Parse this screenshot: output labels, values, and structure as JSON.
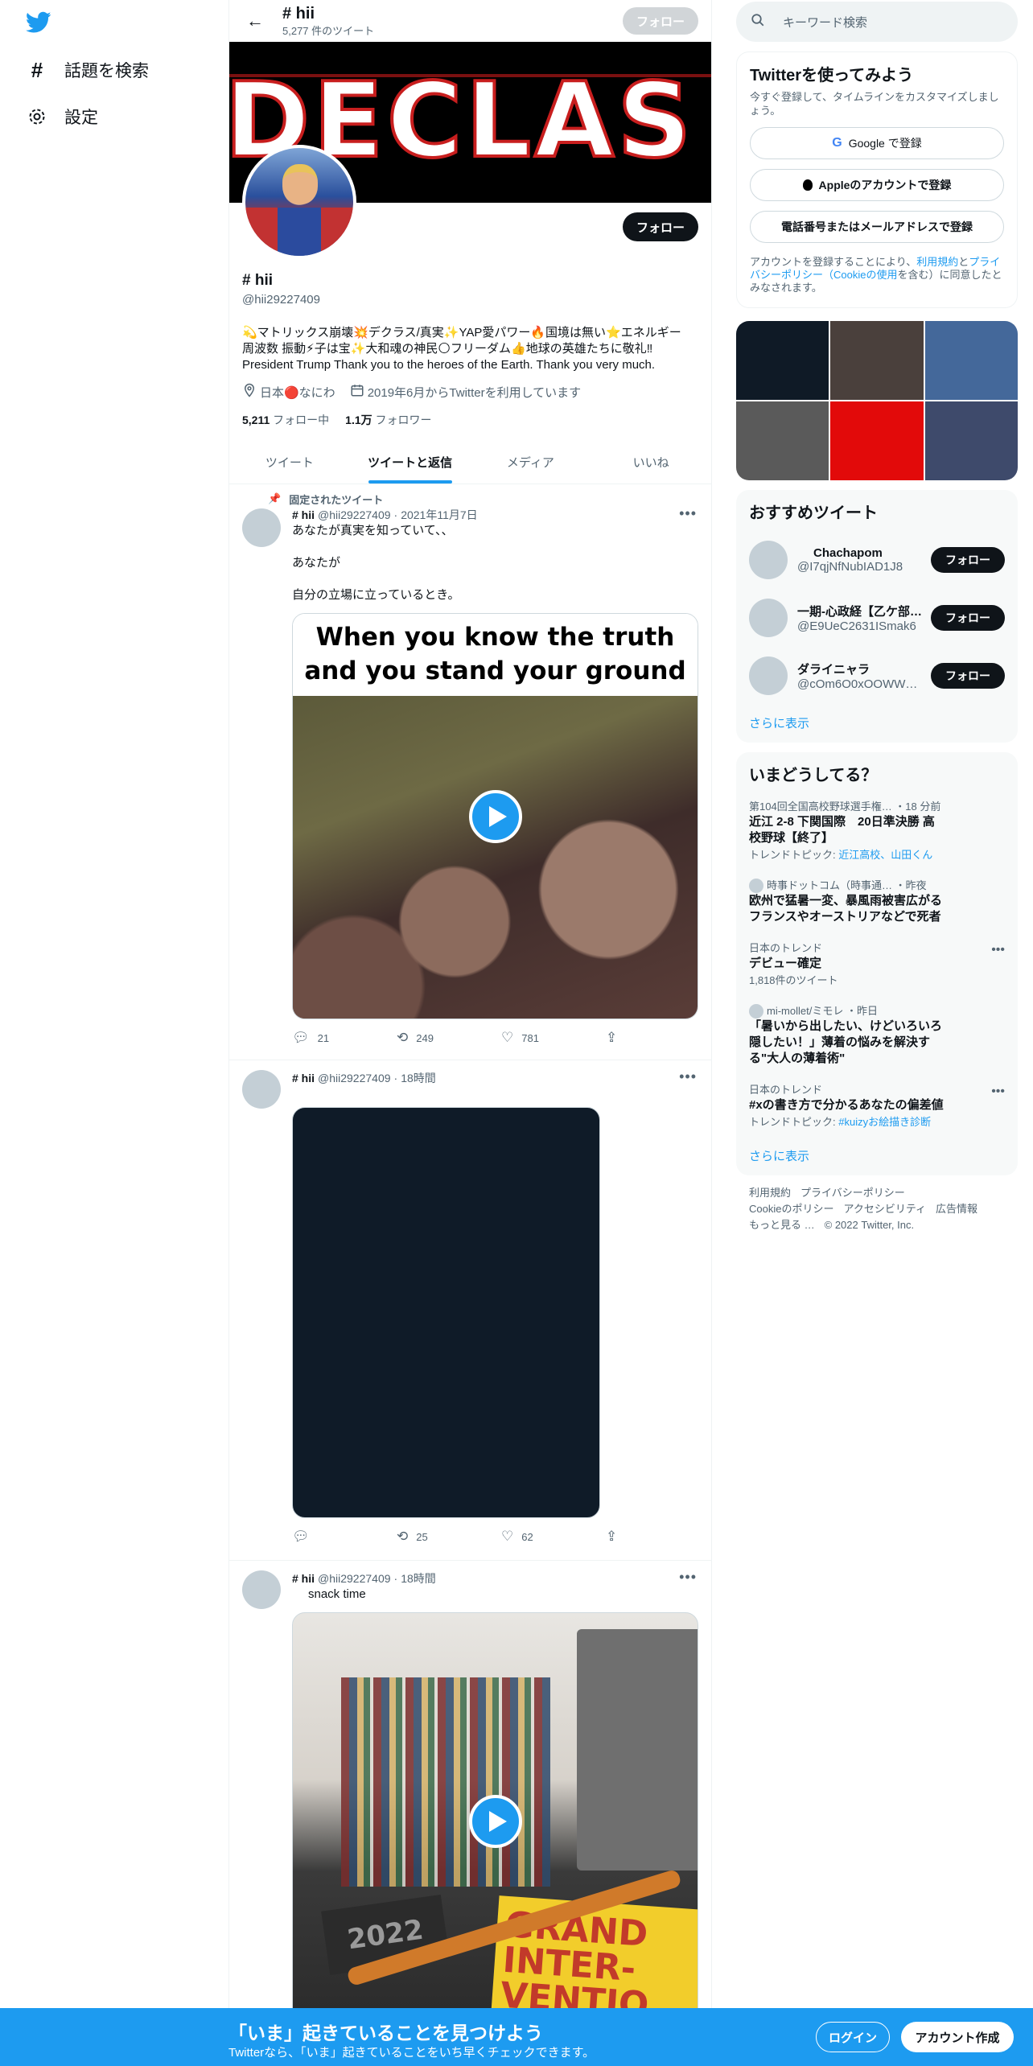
{
  "nav": {
    "explore_label": "話題を検索",
    "settings_label": "設定"
  },
  "header": {
    "name": "# hii",
    "tweet_count": "5,277 件のツイート",
    "follow_label": "フォロー"
  },
  "profile": {
    "banner_text": "DECLAS",
    "name": "# hii",
    "handle": "@hii29227409",
    "follow_label": "フォロー",
    "bio_line1": "💫マトリックス崩壊💥デクラス/真実✨YAP愛パワー🔥国境は無い⭐エネルギー",
    "bio_line2": "周波数 振動⚡子は宝✨大和魂の神民🌕フリーダム👍地球の英雄たちに敬礼‼",
    "bio_line3": "President Trump Thank you to the heroes of the Earth. Thank you very much.",
    "location": "日本🔴なにわ",
    "joined": "2019年6月からTwitterを利用しています",
    "following_count": "5,211",
    "following_label": "フォロー中",
    "followers_count": "1.1万",
    "followers_label": "フォロワー"
  },
  "tabs": [
    "ツイート",
    "ツイートと返信",
    "メディア",
    "いいね"
  ],
  "tweets": [
    {
      "pinned_label": "固定されたツイート",
      "name": "# hii",
      "handle": "@hii29227409",
      "time": "2021年11月7日",
      "line1": "あなたが真実を知っていて、、",
      "line2": "あなたが",
      "line3": "自分の立場に立っているとき。",
      "media_caption_1": "When you know the truth",
      "media_caption_2": "and you stand your ground",
      "replies": "21",
      "retweets": "249",
      "likes": "781"
    },
    {
      "name": "# hii",
      "handle": "@hii29227409",
      "time": "18時間",
      "replies": "",
      "retweets": "25",
      "likes": "62"
    },
    {
      "name": "# hii",
      "handle": "@hii29227409",
      "time": "18時間",
      "text": "snack time",
      "book_text_1": "2022",
      "book_text_2": "GRAND",
      "book_text_3": "INTER-",
      "book_text_4": "VENTIO"
    }
  ],
  "right": {
    "search_placeholder": "キーワード検索",
    "signup": {
      "title": "Twitterを使ってみよう",
      "sub": "今すぐ登録して、タイムラインをカスタマイズしましょう。",
      "google": "Google で登録",
      "apple": "Appleのアカウントで登録",
      "phone": "電話番号またはメールアドレスで登録",
      "legal_1": "アカウントを登録することにより、",
      "legal_link_1": "利用規約",
      "legal_2": "と",
      "legal_link_2": "プライバシーポリシー（Cookieの使用",
      "legal_3": "を含む）に同意したとみなされます。"
    },
    "photo_colors": [
      "#0f1a26",
      "#4a403c",
      "#44689a",
      "#5a5a5a",
      "#e20a0a",
      "#3e4a6b"
    ],
    "who": {
      "title": "おすすめツイート",
      "follow_label": "フォロー",
      "users": [
        {
          "name": "Chachapom",
          "handle": "@I7qjNfNubIAD1J8"
        },
        {
          "name": "一期-心政経【乙ケ部…",
          "handle": "@E9UeC2631ISmak6"
        },
        {
          "name": "ダライニャラ",
          "handle": "@cOm6O0xOOWW…"
        }
      ],
      "more": "さらに表示"
    },
    "trends": {
      "title": "いまどうしてる？",
      "items": [
        {
          "context": "第104回全国高校野球選手権… ・18 分前",
          "name": "近江 2-8 下関国際　20日準決勝 高校野球【終了】",
          "sub_label": "トレンドトピック: ",
          "sub_link": "近江高校、山田くん"
        },
        {
          "context": "時事ドットコム（時事通… ・昨夜",
          "name": "欧州で猛暑一変、暴風雨被害広がる　フランスやオーストリアなどで死者"
        },
        {
          "context": "日本のトレンド",
          "name": "デビュー確定",
          "sub_label": "1,818件のツイート"
        },
        {
          "context": "mi-mollet/ミモレ ・昨日",
          "name": "「暑いから出したい、けどいろいろ隠したい！」薄着の悩みを解決する\"大人の薄着術\""
        },
        {
          "context": "日本のトレンド",
          "name": "#xの書き方で分かるあなたの偏差値",
          "sub_label": "トレンドトピック: ",
          "sub_link": "#kuizyお絵描き診断"
        }
      ],
      "more": "さらに表示"
    },
    "footer": {
      "terms": "利用規約",
      "privacy": "プライバシーポリシー",
      "cookie": "Cookieのポリシー",
      "access": "アクセシビリティ",
      "ads": "広告情報",
      "more": "もっと見る …",
      "copyright": "© 2022 Twitter, Inc."
    }
  },
  "bottom": {
    "title": "「いま」起きていることを見つけよう",
    "sub": "Twitterなら、「いま」起きていることをいち早くチェックできます。",
    "login": "ログイン",
    "signup": "アカウント作成"
  }
}
